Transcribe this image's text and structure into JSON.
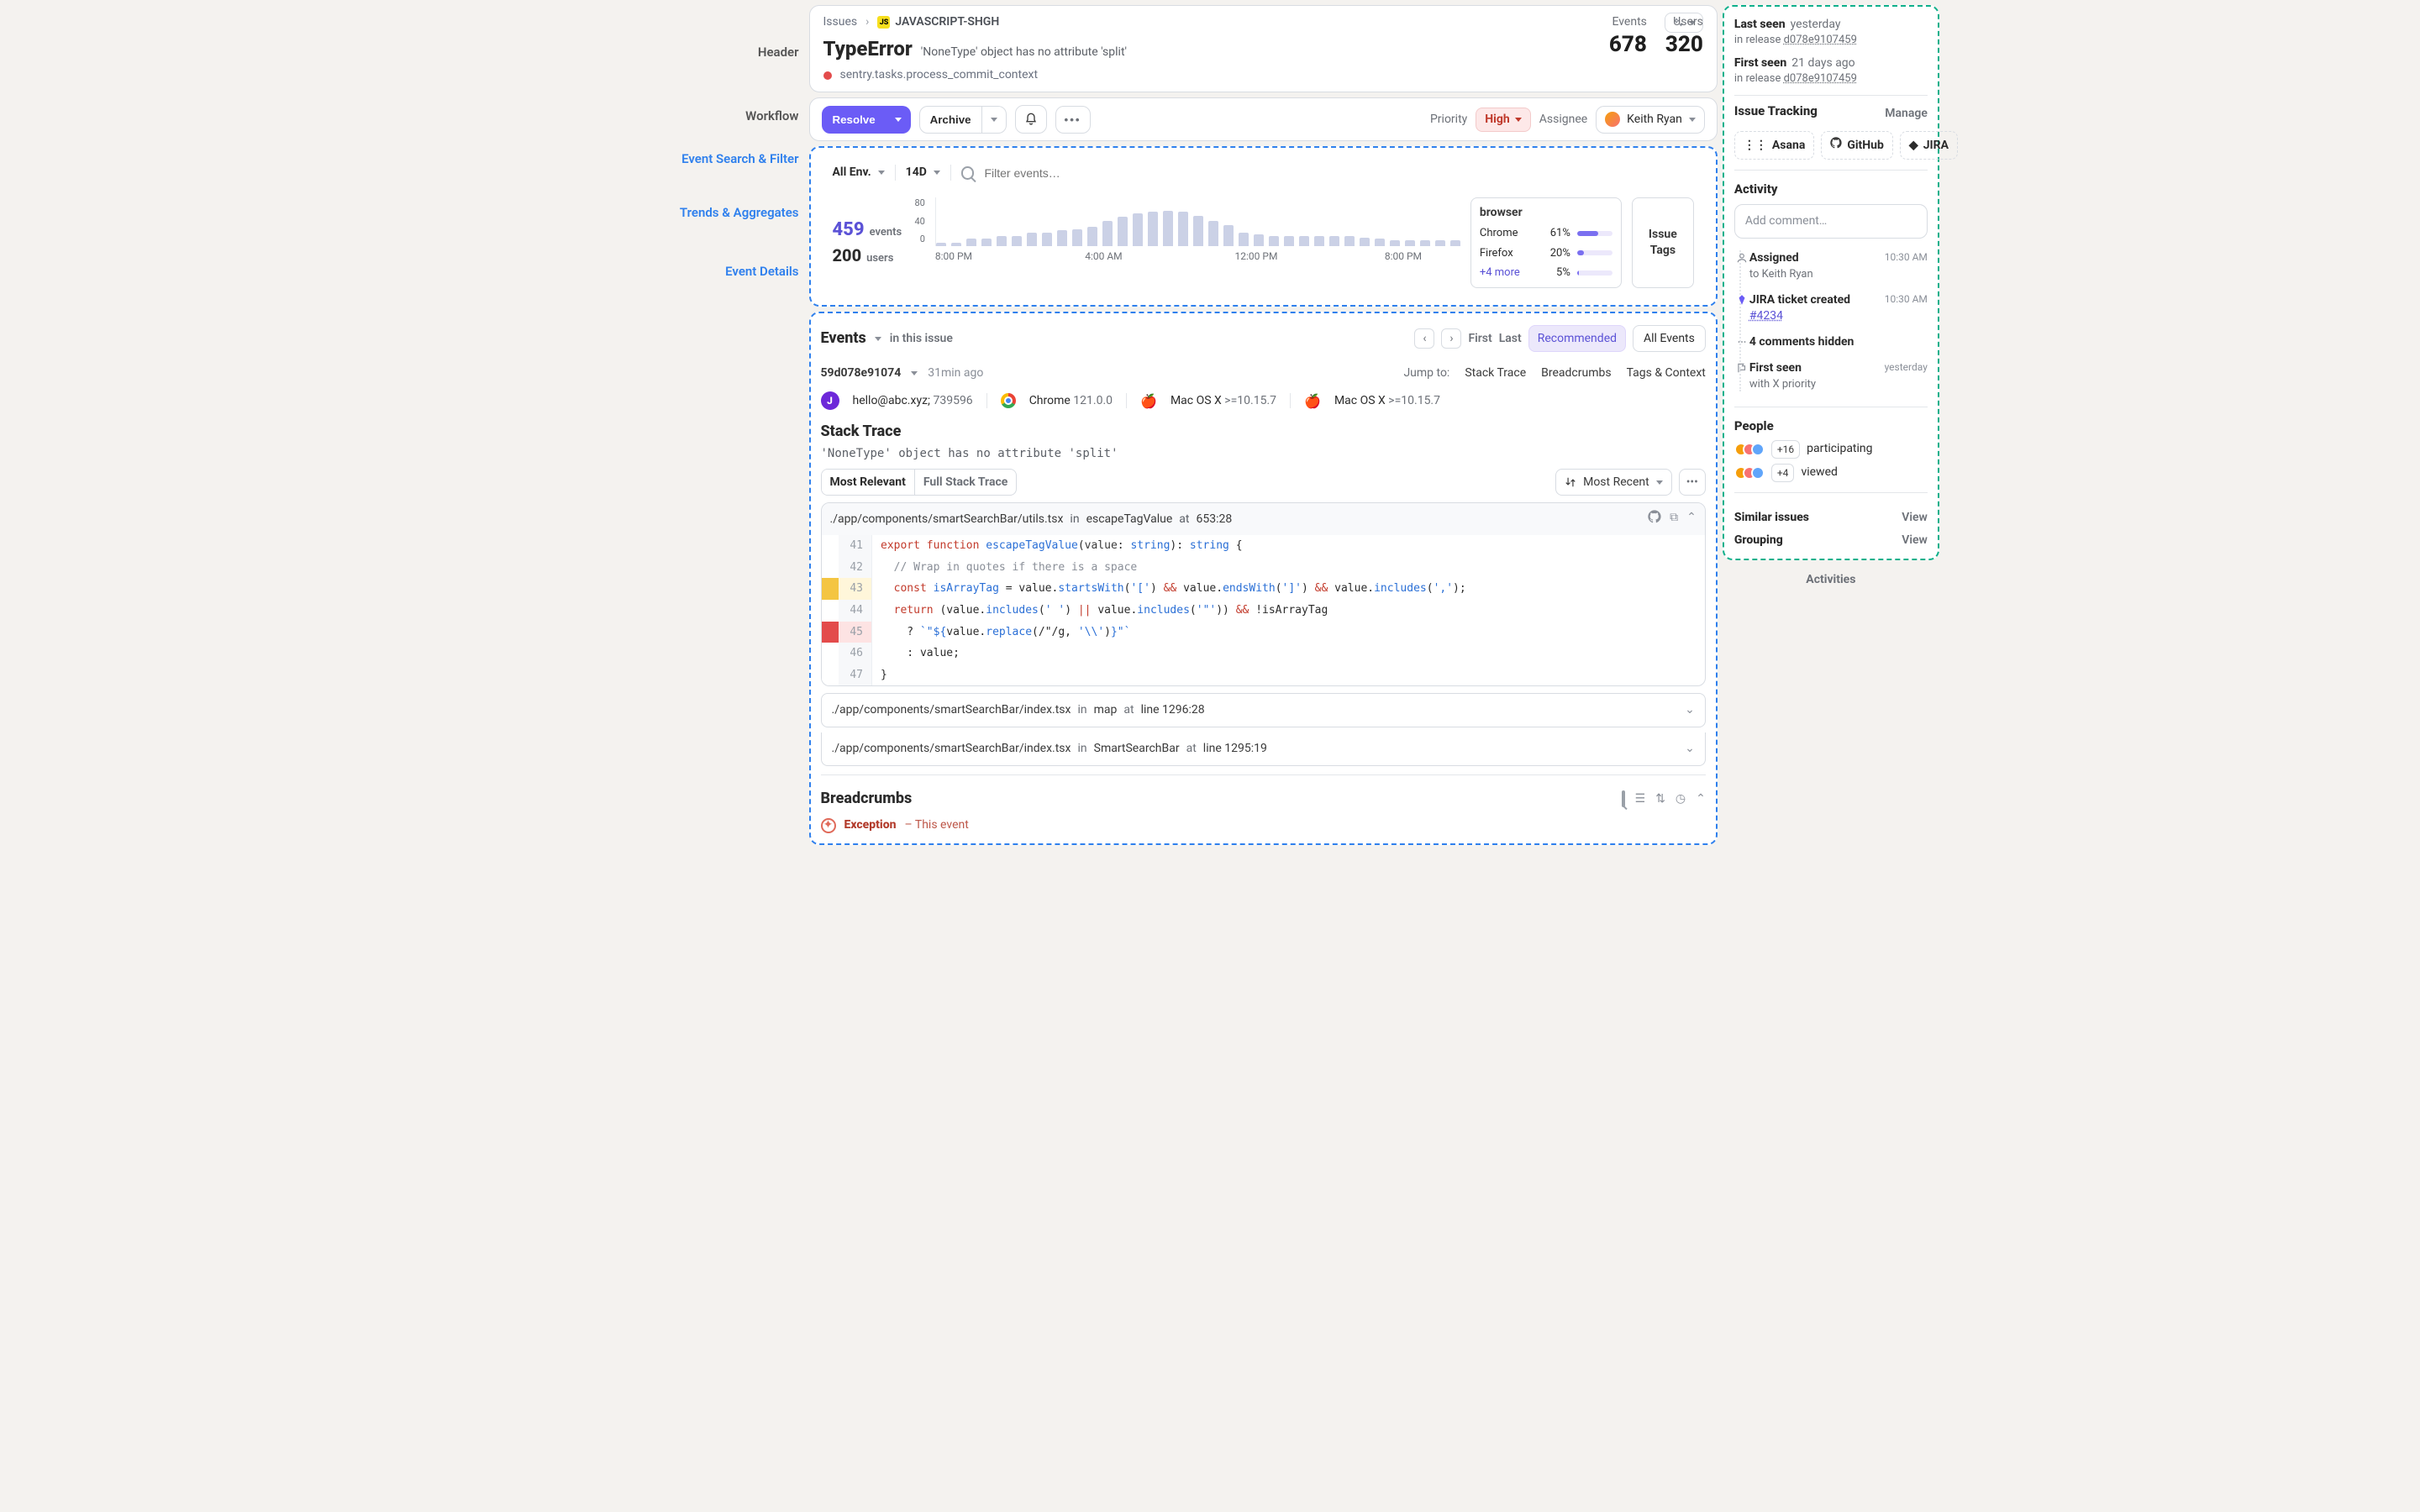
{
  "rail": {
    "header": "Header",
    "workflow": "Workflow",
    "search": "Event Search & Filter",
    "trends": "Trends & Aggregates",
    "details": "Event Details",
    "activities": "Activities"
  },
  "breadcrumbs": {
    "root": "Issues",
    "code": "JAVASCRIPT-SHGH"
  },
  "header": {
    "title": "TypeError",
    "subtitle": "'NoneType' object has no attribute 'split'",
    "context": "sentry.tasks.process_commit_context",
    "events_label": "Events",
    "events_value": "678",
    "users_label": "Users",
    "users_value": "320"
  },
  "workflow": {
    "resolve": "Resolve",
    "archive": "Archive",
    "priority_label": "Priority",
    "priority_value": "High",
    "assignee_label": "Assignee",
    "assignee_name": "Keith Ryan"
  },
  "filter": {
    "env": "All Env.",
    "period": "14D",
    "placeholder": "Filter events…"
  },
  "chart_data": {
    "type": "bar",
    "title": "",
    "xlabel": "",
    "ylabel": "",
    "ylim": [
      0,
      80
    ],
    "yticks": [
      80,
      40,
      0
    ],
    "x_ticks": [
      "8:00 PM",
      "4:00 AM",
      "12:00 PM",
      "8:00 PM"
    ],
    "values": [
      6,
      6,
      12,
      12,
      16,
      16,
      22,
      22,
      26,
      28,
      32,
      42,
      48,
      54,
      56,
      58,
      56,
      50,
      42,
      34,
      22,
      20,
      16,
      16,
      16,
      16,
      16,
      16,
      14,
      12,
      10,
      10,
      10,
      10,
      10
    ]
  },
  "trends": {
    "events_value": "459",
    "events_label": "events",
    "users_value": "200",
    "users_label": "users",
    "tags_title": "browser",
    "tags_more": "+4 more",
    "issue_tags": "Issue\nTags",
    "rows": [
      {
        "name": "Chrome",
        "pct": "61%",
        "w": 61
      },
      {
        "name": "Firefox",
        "pct": "20%",
        "w": 20
      },
      {
        "name": "",
        "pct": "5%",
        "w": 5
      }
    ]
  },
  "events": {
    "title": "Events",
    "subtitle": "in this issue",
    "first": "First",
    "last": "Last",
    "recommended": "Recommended",
    "all": "All Events",
    "event_id": "59d078e91074",
    "event_ago": "31min ago",
    "jump": "Jump to:",
    "jump_links": [
      "Stack Trace",
      "Breadcrumbs",
      "Tags & Context"
    ],
    "user": "hello@abc.xyz;",
    "user_num": "739596",
    "browser": "Chrome",
    "browser_v": "121.0.0",
    "os": "Mac OS X",
    "os_v": ">=10.15.7",
    "os2": "Mac OS X",
    "os2_v": ">=10.15.7"
  },
  "stack": {
    "title": "Stack Trace",
    "subtitle": "'NoneType' object has no attribute 'split'",
    "most_relevant": "Most Relevant",
    "full": "Full Stack Trace",
    "sort": "Most Recent",
    "frame1_file": "./app/components/smartSearchBar/utils.tsx",
    "frame1_in": "in",
    "frame1_fn": "escapeTagValue",
    "frame1_at": "at",
    "frame1_loc": "653:28",
    "lines": [
      {
        "n": "41",
        "gutter": "",
        "html": "<span class='tok-kw'>export</span> <span class='tok-kw'>function</span> <span class='tok-fn'>escapeTagValue</span>(<span class='tok-id'>value</span>: <span class='tok-type'>string</span>): <span class='tok-type'>string</span> {"
      },
      {
        "n": "42",
        "gutter": "",
        "html": "&nbsp;&nbsp;<span class='tok-cmt'>// Wrap in quotes if there is a space</span>"
      },
      {
        "n": "43",
        "gutter": "yellow",
        "html": "&nbsp;&nbsp;<span class='tok-kw'>const</span> <span class='tok-fn'>isArrayTag</span> = value.<span class='tok-fn'>startsWith</span>(<span class='tok-str'>'['</span>) <span class='tok-op'>&amp;&amp;</span> value.<span class='tok-fn'>endsWith</span>(<span class='tok-str'>']'</span>) <span class='tok-op'>&amp;&amp;</span> value.<span class='tok-fn'>includes</span>(<span class='tok-str'>','</span>);"
      },
      {
        "n": "44",
        "gutter": "",
        "html": "&nbsp;&nbsp;<span class='tok-kw'>return</span> (value.<span class='tok-fn'>includes</span>(<span class='tok-str'>' '</span>) <span class='tok-op'>||</span> value.<span class='tok-fn'>includes</span>(<span class='tok-str'>'\"'</span>)) <span class='tok-op'>&amp;&amp;</span> !isArrayTag"
      },
      {
        "n": "45",
        "gutter": "red",
        "html": "&nbsp;&nbsp;&nbsp;&nbsp;? <span class='tok-str'>`\"${</span>value.<span class='tok-fn'>replace</span>(/\"/g, <span class='tok-str'>'\\\\'</span>)<span class='tok-str'>}\"`</span>"
      },
      {
        "n": "46",
        "gutter": "",
        "html": "&nbsp;&nbsp;&nbsp;&nbsp;: value;"
      },
      {
        "n": "47",
        "gutter": "",
        "html": "}"
      }
    ],
    "collapsed": [
      {
        "file": "./app/components/smartSearchBar/index.tsx",
        "in": "in",
        "fn": "map",
        "at": "at",
        "loc": "line 1296:28"
      },
      {
        "file": "./app/components/smartSearchBar/index.tsx",
        "in": "in",
        "fn": "SmartSearchBar",
        "at": "at",
        "loc": "line 1295:19"
      }
    ]
  },
  "bc": {
    "title": "Breadcrumbs",
    "row_title": "Exception",
    "row_sub": "– This event"
  },
  "side": {
    "last_seen_label": "Last seen",
    "last_seen_value": "yesterday",
    "last_seen_rel_pre": "in release",
    "last_seen_rel": "d078e9107459",
    "first_seen_label": "First seen",
    "first_seen_value": "21 days ago",
    "first_seen_rel_pre": "in release",
    "first_seen_rel": "d078e9107459",
    "tracking_title": "Issue Tracking",
    "manage": "Manage",
    "trackers": [
      "Asana",
      "GitHub",
      "JIRA"
    ],
    "activity_title": "Activity",
    "add_comment": "Add comment…",
    "items": [
      {
        "title": "Assigned",
        "sub": "to Keith Ryan",
        "time": "10:30 AM",
        "icon": "user"
      },
      {
        "title": "JIRA ticket created",
        "sub": "#4234",
        "time": "10:30 AM",
        "icon": "diamond",
        "ticket": true
      },
      {
        "title": "4 comments hidden",
        "sub": "",
        "time": "",
        "icon": "dots"
      },
      {
        "title": "First seen",
        "sub": "with X priority",
        "time": "yesterday",
        "icon": "flag"
      }
    ],
    "people_title": "People",
    "people_rows": [
      {
        "count": "+16",
        "label": "participating"
      },
      {
        "count": "+4",
        "label": "viewed"
      }
    ],
    "similar": "Similar issues",
    "grouping": "Grouping",
    "view": "View"
  }
}
